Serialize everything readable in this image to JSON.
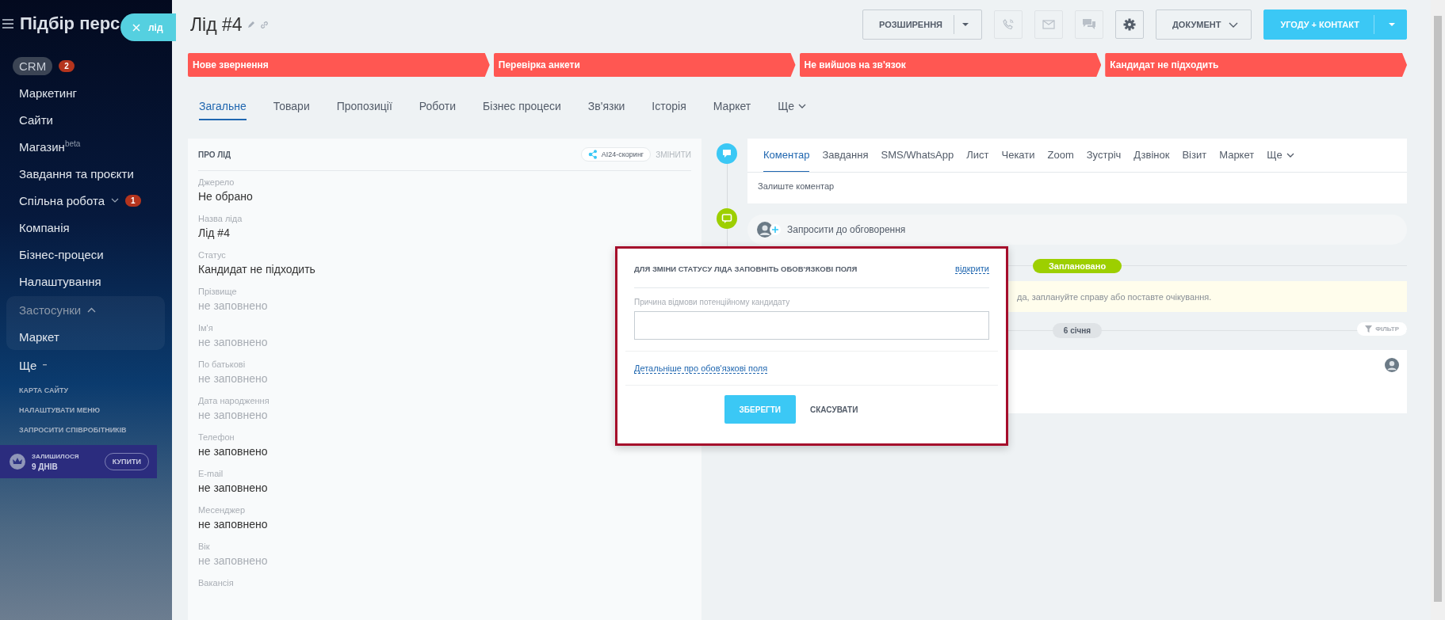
{
  "sidebar": {
    "title": "Підбір перс",
    "lead_chip": {
      "label": "лід"
    },
    "items": [
      {
        "label": "CRM",
        "selected": true,
        "counter": "2",
        "has_menu": false
      },
      {
        "label": "Маркетинг",
        "selected": false,
        "has_menu": false
      },
      {
        "label": "Сайти",
        "selected": false,
        "has_menu": false
      },
      {
        "label": "Магазин$^{beta}$",
        "selected": false,
        "has_menu": false
      },
      {
        "label": "Завдання та проєкти",
        "selected": false,
        "has_menu": false
      },
      {
        "label": "Спільна робота",
        "selected": false,
        "counter": "1",
        "has_menu": true
      },
      {
        "label": "Компанія",
        "selected": false,
        "has_menu": false
      },
      {
        "label": "Бізнес-процеси",
        "selected": false,
        "has_menu": false
      },
      {
        "label": "Налаштування",
        "selected": false,
        "has_menu": false
      }
    ],
    "group": {
      "label": "Застосунки",
      "expanded": true,
      "children": [
        {
          "label": "Маркет"
        }
      ]
    },
    "more": {
      "label": "Ще"
    },
    "links": [
      "КАРТА САЙТУ",
      "НАЛАШТУВАТИ МЕНЮ",
      "ЗАПРОСИТИ СПІВРОБІТНИКІВ"
    ],
    "trial": {
      "caption": "ЗАЛИШИЛОСЯ",
      "days": "9 ДНІВ",
      "button": "КУПИТИ"
    }
  },
  "header": {
    "title": "Лід #4",
    "extensions": "РОЗШИРЕННЯ",
    "document": "ДОКУМЕНТ",
    "create": "УГОДУ + КОНТАКТ"
  },
  "stages": [
    {
      "label": "Нове звернення",
      "reached": true
    },
    {
      "label": "Перевірка анкети",
      "reached": true
    },
    {
      "label": "Не вийшов на зв'язок",
      "reached": true
    },
    {
      "label": "Кандидат не підходить",
      "reached": true
    }
  ],
  "tabs": [
    {
      "label": "Загальне",
      "selected": true
    },
    {
      "label": "Товари",
      "selected": false
    },
    {
      "label": "Пропозиції",
      "selected": false
    },
    {
      "label": "Роботи",
      "selected": false
    },
    {
      "label": "Бізнес процеси",
      "selected": false
    },
    {
      "label": "Зв'язки",
      "selected": false
    },
    {
      "label": "Історія",
      "selected": false
    },
    {
      "label": "Маркет",
      "selected": false
    }
  ],
  "tabs_more": "Ще",
  "lead_panel": {
    "title": "ПРО ЛІД",
    "scoring": "AI24-скоринг",
    "edit": "ЗМІНИТИ",
    "fields": [
      {
        "label": "Джерело",
        "value": "Не обрано",
        "muted": false
      },
      {
        "label": "Назва ліда",
        "value": "Лід #4",
        "muted": false
      },
      {
        "label": "Статус",
        "value": "Кандидат не підходить",
        "muted": false
      },
      {
        "label": "Прізвище",
        "value": "не заповнено",
        "muted": true
      },
      {
        "label": "Ім'я",
        "value": "не заповнено",
        "muted": true
      },
      {
        "label": "По батькові",
        "value": "не заповнено",
        "muted": true
      },
      {
        "label": "Дата народження",
        "value": "не заповнено",
        "muted": true
      },
      {
        "label": "Телефон",
        "value": "не заповнено",
        "muted": false
      },
      {
        "label": "E-mail",
        "value": "не заповнено",
        "muted": false
      },
      {
        "label": "Месенджер",
        "value": "не заповнено",
        "muted": false
      },
      {
        "label": "Вік",
        "value": "не заповнено",
        "muted": true
      },
      {
        "label": "Вакансія"
      }
    ]
  },
  "activity": {
    "tabs": [
      {
        "label": "Коментар",
        "selected": true
      },
      {
        "label": "Завдання",
        "selected": false
      },
      {
        "label": "SMS/WhatsApp",
        "selected": false
      },
      {
        "label": "Лист",
        "selected": false
      },
      {
        "label": "Чекати",
        "selected": false
      },
      {
        "label": "Zoom",
        "selected": false
      },
      {
        "label": "Зустріч",
        "selected": false
      },
      {
        "label": "Дзвінок",
        "selected": false
      },
      {
        "label": "Візит",
        "selected": false
      },
      {
        "label": "Маркет",
        "selected": false
      }
    ],
    "more": "Ще",
    "placeholder": "Залиште коментар",
    "invite": "Запросити до обговорення",
    "planned": "Заплановано",
    "notice": "да, заплануйте справу або поставте очікування.",
    "date": "6 січня",
    "filter": "ФІЛЬТР"
  },
  "modal": {
    "title": "ДЛЯ ЗМІНИ СТАТУСУ ЛІДА ЗАПОВНІТЬ ОБОВ'ЯЗКОВІ ПОЛЯ",
    "open_link": "відкрити",
    "field_label": "Причина відмови потенційному кандидату",
    "help_link": "Детальніше про обов'язкові поля",
    "save": "ЗБЕРЕГТИ",
    "cancel": "СКАСУВАТИ"
  }
}
